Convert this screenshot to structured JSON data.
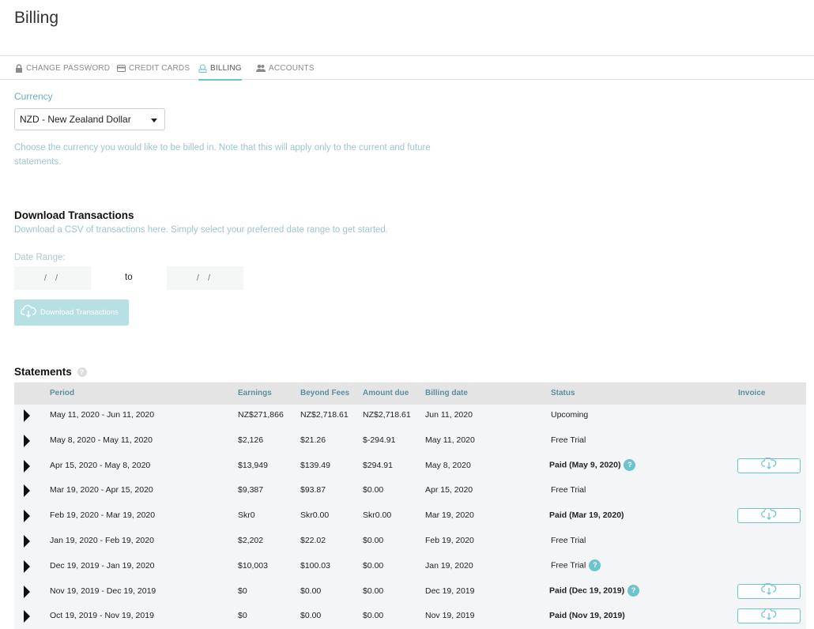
{
  "page": {
    "title": "Billing"
  },
  "tabs": [
    {
      "label": "CHANGE PASSWORD",
      "icon": "lock-icon",
      "active": false
    },
    {
      "label": "CREDIT CARDS",
      "icon": "credit-card-icon",
      "active": false
    },
    {
      "label": "BILLING",
      "icon": "billing-icon",
      "active": true
    },
    {
      "label": "ACCOUNTS",
      "icon": "users-icon",
      "active": false
    }
  ],
  "currency": {
    "label": "Currency",
    "selected": "NZD - New Zealand Dollar",
    "help": "Choose the currency you would like to be billed in. Note that this will apply only to the current and future statements."
  },
  "download": {
    "title": "Download Transactions",
    "description": "Download a CSV of transactions here. Simply select your preferred date range to get started.",
    "date_range_label": "Date Range:",
    "from_placeholder": "/ /",
    "to_label": "to",
    "to_placeholder": "/ /",
    "button_label": "Download Transactions"
  },
  "statements": {
    "title": "Statements",
    "help_glyph": "?",
    "columns": [
      "Period",
      "Earnings",
      "Beyond Fees",
      "Amount due",
      "Billing date",
      "Status",
      "Invoice"
    ],
    "rows": [
      {
        "period": "May 11, 2020 - Jun 11, 2020",
        "earnings": "NZ$271,866",
        "fees": "NZ$2,718.61",
        "due": "NZ$2,718.61",
        "billing_date": "Jun 11, 2020",
        "status": "Upcoming",
        "bold": false,
        "help": false,
        "invoice": false
      },
      {
        "period": "May 8, 2020 - May 11, 2020",
        "earnings": "$2,126",
        "fees": "$21.26",
        "due": "$-294.91",
        "billing_date": "May 11, 2020",
        "status": "Free Trial",
        "bold": false,
        "help": false,
        "invoice": false
      },
      {
        "period": "Apr 15, 2020 - May 8, 2020",
        "earnings": "$13,949",
        "fees": "$139.49",
        "due": "$294.91",
        "billing_date": "May 8, 2020",
        "status": "Paid (May 9, 2020)",
        "bold": true,
        "help": true,
        "invoice": true
      },
      {
        "period": "Mar 19, 2020 - Apr 15, 2020",
        "earnings": "$9,387",
        "fees": "$93.87",
        "due": "$0.00",
        "billing_date": "Apr 15, 2020",
        "status": "Free Trial",
        "bold": false,
        "help": false,
        "invoice": false
      },
      {
        "period": "Feb 19, 2020 - Mar 19, 2020",
        "earnings": "Skr0",
        "fees": "Skr0.00",
        "due": "Skr0.00",
        "billing_date": "Mar 19, 2020",
        "status": "Paid (Mar 19, 2020)",
        "bold": true,
        "help": false,
        "invoice": true
      },
      {
        "period": "Jan 19, 2020 - Feb 19, 2020",
        "earnings": "$2,202",
        "fees": "$22.02",
        "due": "$0.00",
        "billing_date": "Feb 19, 2020",
        "status": "Free Trial",
        "bold": false,
        "help": false,
        "invoice": false
      },
      {
        "period": "Dec 19, 2019 - Jan 19, 2020",
        "earnings": "$10,003",
        "fees": "$100.03",
        "due": "$0.00",
        "billing_date": "Jan 19, 2020",
        "status": "Free Trial",
        "bold": false,
        "help": true,
        "invoice": false
      },
      {
        "period": "Nov 19, 2019 - Dec 19, 2019",
        "earnings": "$0",
        "fees": "$0.00",
        "due": "$0.00",
        "billing_date": "Dec 19, 2019",
        "status": "Paid (Dec 19, 2019)",
        "bold": true,
        "help": true,
        "invoice": true
      },
      {
        "period": "Oct 19, 2019 - Nov 19, 2019",
        "earnings": "$0",
        "fees": "$0.00",
        "due": "$0.00",
        "billing_date": "Nov 19, 2019",
        "status": "Paid (Nov 19, 2019)",
        "bold": true,
        "help": false,
        "invoice": true
      }
    ]
  },
  "colors": {
    "accent": "#6cc4cc",
    "muted_text": "#9cc5cf",
    "header_text": "#5e8ea0"
  }
}
